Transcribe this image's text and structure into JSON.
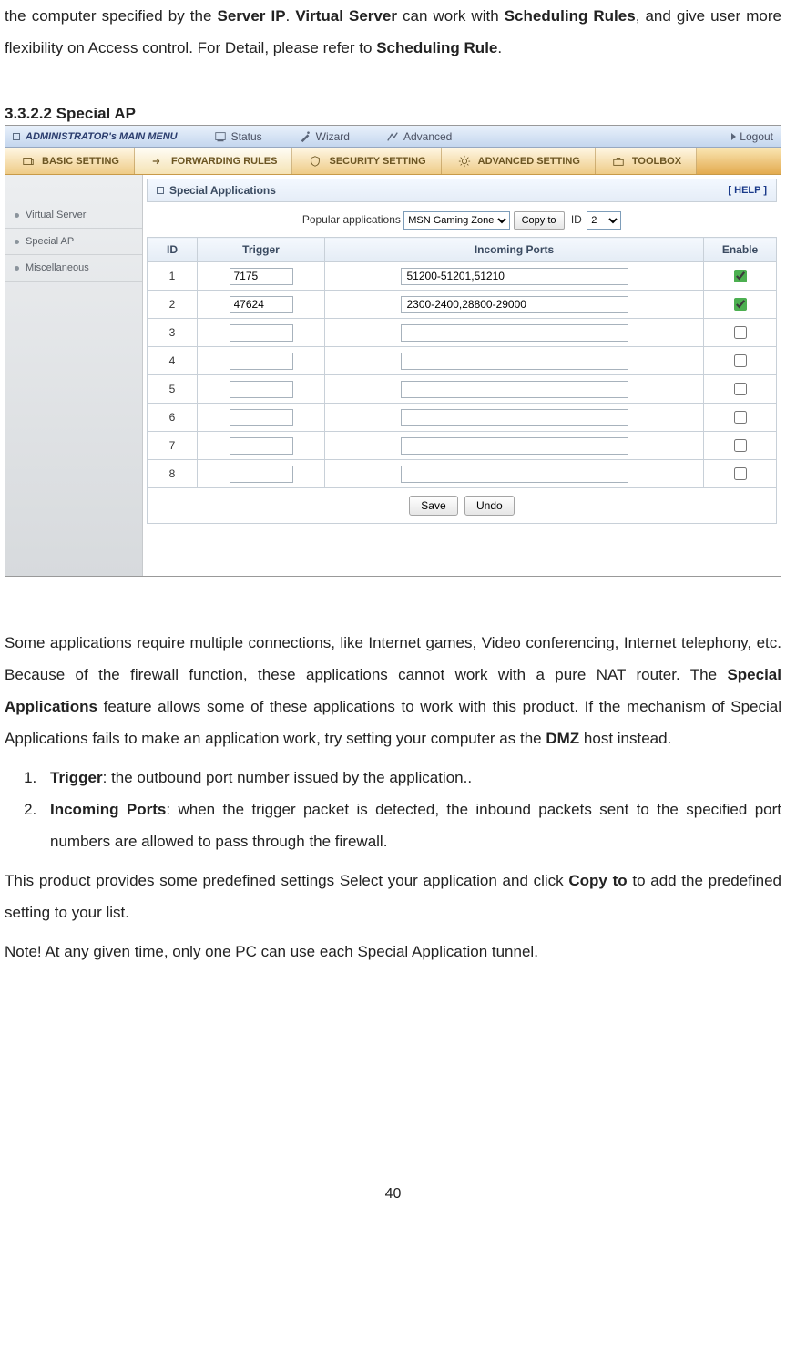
{
  "intro_para": {
    "t1": "the computer specified by the ",
    "b1": "Server IP",
    "t2": ".   ",
    "b2": "Virtual Server",
    "t3": " can work with ",
    "b3": "Scheduling Rules",
    "t4": ", and give user more flexibility on Access control. For Detail, please refer to ",
    "b4": "Scheduling Rule",
    "t5": "."
  },
  "section_heading": "3.3.2.2 Special AP",
  "router": {
    "top": {
      "title": "ADMINISTRATOR's MAIN MENU",
      "items": [
        "Status",
        "Wizard",
        "Advanced"
      ],
      "logout": "Logout"
    },
    "tabs": [
      "BASIC SETTING",
      "FORWARDING RULES",
      "SECURITY SETTING",
      "ADVANCED SETTING",
      "TOOLBOX"
    ],
    "active_tab_index": 1,
    "sidebar": [
      "Virtual Server",
      "Special AP",
      "Miscellaneous"
    ],
    "panel_title": "Special Applications",
    "help_label": "[ HELP ]",
    "popapps": {
      "label": "Popular applications",
      "select_value": "MSN Gaming Zone",
      "copy_button": "Copy to",
      "id_label": "ID",
      "id_value": "2"
    },
    "columns": {
      "c1": "ID",
      "c2": "Trigger",
      "c3": "Incoming Ports",
      "c4": "Enable"
    },
    "rows": [
      {
        "id": "1",
        "trigger": "7175",
        "ports": "51200-51201,51210",
        "enabled": true
      },
      {
        "id": "2",
        "trigger": "47624",
        "ports": "2300-2400,28800-29000",
        "enabled": true
      },
      {
        "id": "3",
        "trigger": "",
        "ports": "",
        "enabled": false
      },
      {
        "id": "4",
        "trigger": "",
        "ports": "",
        "enabled": false
      },
      {
        "id": "5",
        "trigger": "",
        "ports": "",
        "enabled": false
      },
      {
        "id": "6",
        "trigger": "",
        "ports": "",
        "enabled": false
      },
      {
        "id": "7",
        "trigger": "",
        "ports": "",
        "enabled": false
      },
      {
        "id": "8",
        "trigger": "",
        "ports": "",
        "enabled": false
      }
    ],
    "save_label": "Save",
    "undo_label": "Undo"
  },
  "after": {
    "p1a": "Some applications require multiple connections, like Internet games, Video conferencing, Internet telephony, etc. Because of the firewall function, these applications cannot work with a pure NAT router. The ",
    "p1b": "Special Applications",
    "p1c": " feature allows some of these applications to work with this product. If the mechanism of Special Applications fails to make an application work, try setting your computer as the ",
    "p1d": "DMZ",
    "p1e": " host instead.",
    "li1a": "Trigger",
    "li1b": ": the outbound port number issued by the application..",
    "li2a": "Incoming Ports",
    "li2b": ": when the trigger packet is detected, the inbound packets sent to the specified port numbers are allowed to pass through the firewall.",
    "p2a": "This product provides some predefined settings Select your application and click ",
    "p2b": "Copy to",
    "p2c": " to add the predefined setting to your list.",
    "p3": "Note! At any given time, only one PC can use each Special Application tunnel."
  },
  "page_number": "40"
}
